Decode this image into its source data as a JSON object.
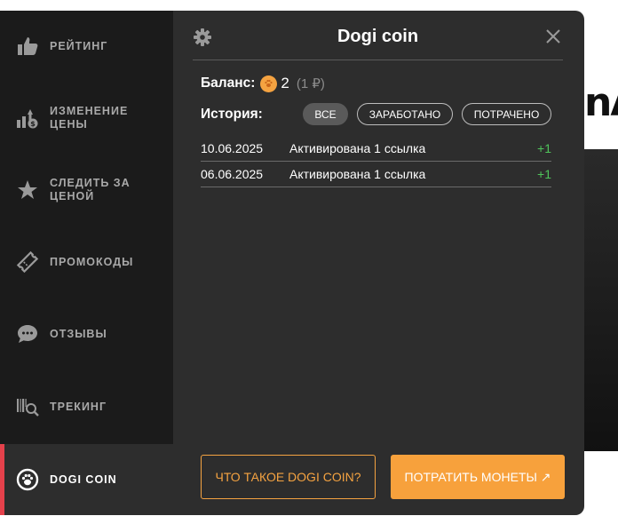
{
  "colors": {
    "accent": "#f7a13c",
    "active_marker": "#e5414b",
    "positive": "#4fc45a",
    "sidebar_bg": "#1b1b1b",
    "panel_bg": "#2d2d2d"
  },
  "background_page": {
    "heading_fragment": "nA"
  },
  "sidebar": {
    "items": [
      {
        "label": "РЕЙТИНГ",
        "icon": "thumbs-up-icon"
      },
      {
        "label": "ИЗМЕНЕНИЕ\nЦЕНЫ",
        "icon": "price-change-icon"
      },
      {
        "label": "СЛЕДИТЬ ЗА\nЦЕНОЙ",
        "icon": "star-icon"
      },
      {
        "label": "ПРОМОКОДЫ",
        "icon": "ticket-icon"
      },
      {
        "label": "ОТЗЫВЫ",
        "icon": "chat-bubble-icon"
      },
      {
        "label": "ТРЕКИНГ",
        "icon": "barcode-search-icon"
      },
      {
        "label": "DOGI COIN",
        "icon": "paw-icon",
        "active": true
      }
    ]
  },
  "header": {
    "title": "Dogi coin",
    "settings_icon": "gear-icon",
    "close_icon": "close-icon"
  },
  "balance": {
    "label": "Баланс:",
    "amount": "2",
    "rub": "(1 ₽)",
    "coin_icon": "dogi-coin-icon"
  },
  "history": {
    "label": "История:",
    "filters": [
      {
        "label": "ВСЕ",
        "active": true
      },
      {
        "label": "ЗАРАБОТАНО",
        "active": false
      },
      {
        "label": "ПОТРАЧЕНО",
        "active": false
      }
    ],
    "rows": [
      {
        "date": "10.06.2025",
        "description": "Активирована 1 ссылка",
        "delta": "+1"
      },
      {
        "date": "06.06.2025",
        "description": "Активирована 1 ссылка",
        "delta": "+1"
      }
    ]
  },
  "buttons": {
    "what_is": "ЧТО ТАКОЕ DOGI COIN?",
    "spend": "ПОТРАТИТЬ МОНЕТЫ ↗"
  }
}
